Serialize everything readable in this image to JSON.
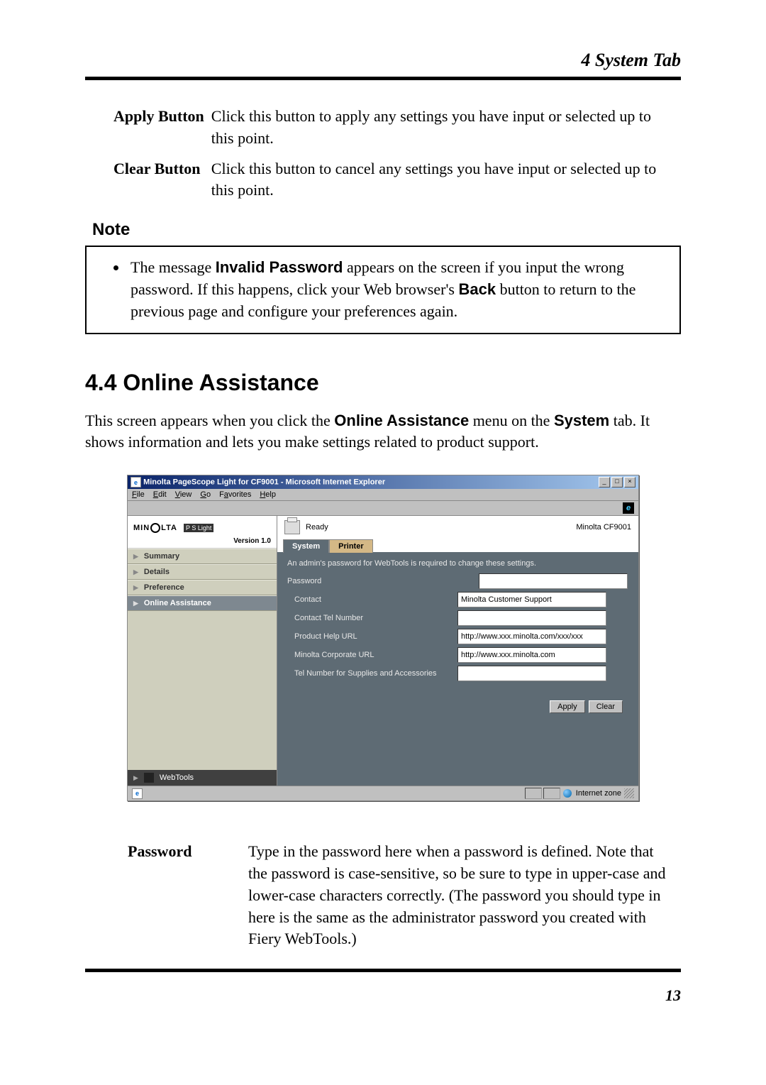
{
  "header": {
    "chapter": "4  System Tab"
  },
  "defs": {
    "apply": {
      "label": "Apply Button",
      "desc": "Click this button to apply any settings you have input or selected up to this point."
    },
    "clear": {
      "label": "Clear Button",
      "desc": "Click this button to cancel any settings you have input or selected up to this point."
    }
  },
  "note": {
    "heading": "Note",
    "t1": "The message ",
    "bold1": "Invalid Password",
    "t2": " appears on the screen if you input the wrong password. If this happens, click your Web browser's ",
    "bold2": "Back",
    "t3": " button to return to the previous page and configure your preferences again."
  },
  "section": {
    "title": "4.4   Online Assistance",
    "p1a": "This screen appears when you click the ",
    "p1b": "Online Assistance",
    "p1c": " menu on the ",
    "p1d": "System",
    "p1e": " tab. It shows information and lets you make settings related to product support."
  },
  "screenshot": {
    "window_title": "Minolta PageScope Light for CF9001 - Microsoft Internet Explorer",
    "menubar": {
      "file": "File",
      "edit": "Edit",
      "view": "View",
      "go": "Go",
      "favorites": "Favorites",
      "help": "Help"
    },
    "branding": {
      "minolta": "MIN",
      "minolta2": "LTA",
      "pslight": "PageScope Light",
      "version": "Version 1.0"
    },
    "nav": {
      "summary": "Summary",
      "details": "Details",
      "preference": "Preference",
      "online": "Online Assistance",
      "webtools": "WebTools"
    },
    "status": {
      "ready": "Ready",
      "model": "Minolta CF9001"
    },
    "tabs": {
      "system": "System",
      "printer": "Printer"
    },
    "form": {
      "note": "An admin's password for WebTools is required to change these settings.",
      "password_label": "Password",
      "password_value": "",
      "contact_label": "Contact",
      "contact_value": "Minolta Customer Support",
      "contact_tel_label": "Contact Tel Number",
      "contact_tel_value": "",
      "help_url_label": "Product Help URL",
      "help_url_value": "http://www.xxx.minolta.com/xxx/xxx",
      "corp_url_label": "Minolta Corporate URL",
      "corp_url_value": "http://www.xxx.minolta.com",
      "supplies_label": "Tel Number for Supplies and Accessories",
      "supplies_value": "",
      "apply_btn": "Apply",
      "clear_btn": "Clear"
    },
    "statusbar": {
      "zone": "Internet zone"
    }
  },
  "password_def": {
    "label": "Password",
    "desc": "Type in the password here when a password is defined. Note that the password is case-sensitive, so be sure to type in upper-case and lower-case characters correctly. (The password you should type in here is the same as the administrator password you created with Fiery WebTools.)"
  },
  "page_number": "13"
}
